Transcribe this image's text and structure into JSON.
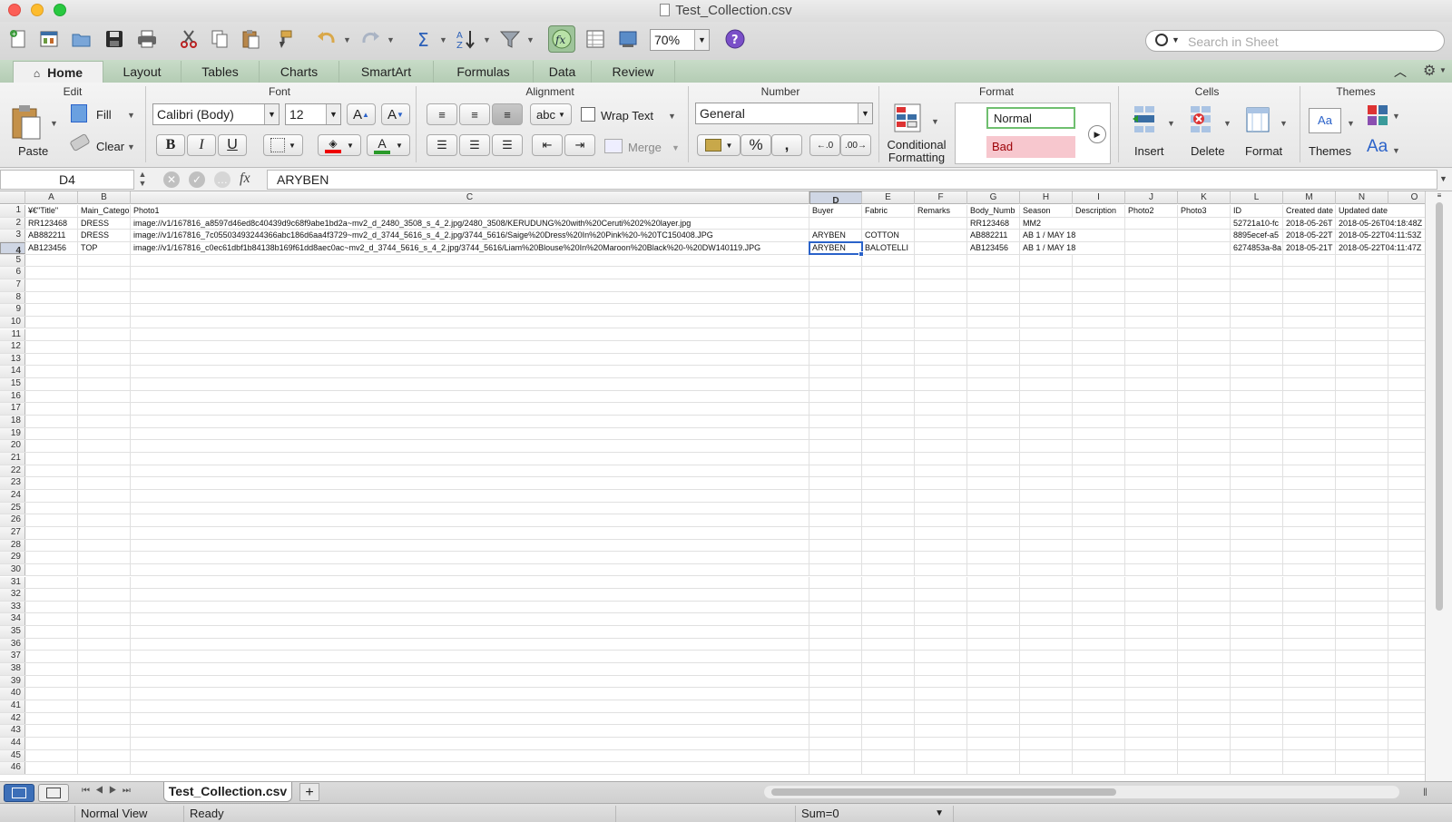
{
  "window": {
    "title": "Test_Collection.csv"
  },
  "toolbar": {
    "zoom": "70%",
    "search_placeholder": "Search in Sheet",
    "icons": [
      "new-workbook-icon",
      "templates-icon",
      "open-icon",
      "save-icon",
      "print-icon",
      "cut-icon",
      "copy-icon",
      "paste-icon",
      "format-painter-icon",
      "undo-icon",
      "redo-icon",
      "autosum-icon",
      "sort-icon",
      "filter-icon",
      "formula-builder-icon",
      "show-hide-icon",
      "gallery-icon",
      "help-icon"
    ]
  },
  "ribbon_tabs": [
    "Home",
    "Layout",
    "Tables",
    "Charts",
    "SmartArt",
    "Formulas",
    "Data",
    "Review"
  ],
  "ribbon": {
    "groups": {
      "edit": "Edit",
      "font": "Font",
      "alignment": "Alignment",
      "number": "Number",
      "format": "Format",
      "cells": "Cells",
      "themes": "Themes"
    },
    "paste": "Paste",
    "fill": "Fill",
    "clear": "Clear",
    "font_name": "Calibri (Body)",
    "font_size": "12",
    "bold": "B",
    "italic": "I",
    "underline": "U",
    "wrap_text": "Wrap Text",
    "abc": "abc",
    "merge": "Merge",
    "number_format": "General",
    "percent": "%",
    "comma": ",",
    "conditional_1": "Conditional",
    "conditional_2": "Formatting",
    "style_normal": "Normal",
    "style_bad": "Bad",
    "insert": "Insert",
    "delete": "Delete",
    "format": "Format",
    "themes": "Themes",
    "aa": "Aa",
    "inc_font": "A",
    "dec_font": "A"
  },
  "formula_bar": {
    "name_box": "D4",
    "fx": "fx",
    "value": "ARYBEN"
  },
  "columns": [
    "A",
    "B",
    "C",
    "D",
    "E",
    "F",
    "G",
    "H",
    "I",
    "J",
    "K",
    "L",
    "M",
    "N",
    "O"
  ],
  "rows": [
    [
      "¥€\"Title\"",
      "Main_Catego",
      "Photo1",
      "Buyer",
      "Fabric",
      "Remarks",
      "Body_Numb",
      "Season",
      "Description",
      "Photo2",
      "Photo3",
      "ID",
      "Created date",
      "Updated date",
      ""
    ],
    [
      "RR123468",
      "DRESS",
      "image://v1/167816_a8597d46ed8c40439d9c68f9abe1bd2a~mv2_d_2480_3508_s_4_2.jpg/2480_3508/KERUDUNG%20with%20Ceruti%202%20layer.jpg",
      "",
      "",
      "",
      "RR123468",
      "MM2",
      "",
      "",
      "",
      "52721a10-fc",
      "2018-05-26T",
      "2018-05-26T04:18:48Z",
      ""
    ],
    [
      "AB882211",
      "DRESS",
      "image://v1/167816_7c05503493244366abc186d6aa4f3729~mv2_d_3744_5616_s_4_2.jpg/3744_5616/Saige%20Dress%20In%20Pink%20-%20TC150408.JPG",
      "ARYBEN",
      "COTTON",
      "",
      "AB882211",
      "AB 1 / MAY 18",
      "",
      "",
      "",
      "8895ecef-a5",
      "2018-05-22T",
      "2018-05-22T04:11:53Z",
      ""
    ],
    [
      "AB123456",
      "TOP",
      "image://v1/167816_c0ec61dbf1b84138b169f61dd8aec0ac~mv2_d_3744_5616_s_4_2.jpg/3744_5616/Liam%20Blouse%20In%20Maroon%20Black%20-%20DW140119.JPG",
      "ARYBEN",
      "BALOTELLI",
      "",
      "AB123456",
      "AB 1 / MAY 18",
      "",
      "",
      "",
      "6274853a-8a",
      "2018-05-21T",
      "2018-05-22T04:11:47Z",
      ""
    ]
  ],
  "row_count": 46,
  "active_cell": {
    "col": 3,
    "row": 3
  },
  "sheet_tab": "Test_Collection.csv",
  "add_sheet": "+",
  "status": {
    "view": "Normal View",
    "state": "Ready",
    "sum": "Sum=0"
  },
  "colors": {
    "accent": "#2a62c9",
    "ribbon_tab_bar": "#b4ccb4",
    "bad_fill": "#f7c7ce",
    "normal_border": "#6fbf6f"
  }
}
